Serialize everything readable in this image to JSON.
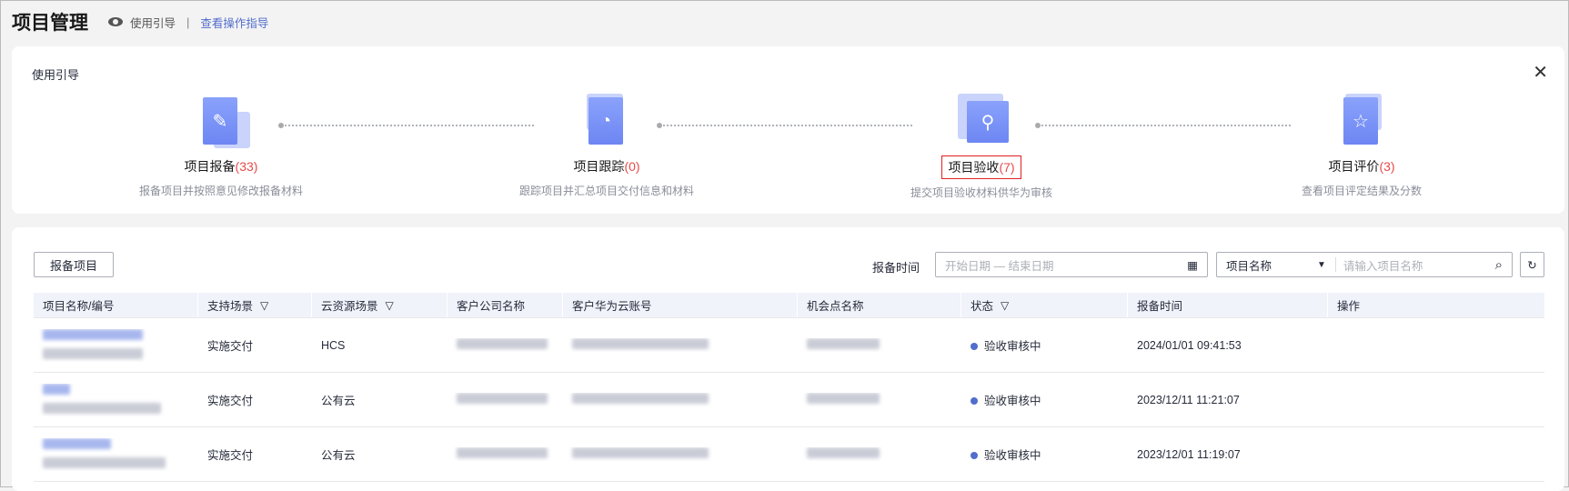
{
  "header": {
    "title": "项目管理",
    "guide_label": "使用引导",
    "separator": "|",
    "guide_link": "查看操作指导"
  },
  "guide": {
    "title": "使用引导",
    "close": "✕",
    "steps": [
      {
        "name": "项目报备",
        "count": "(33)",
        "desc": "报备项目并按照意见修改报备材料",
        "icon": "document-edit-icon"
      },
      {
        "name": "项目跟踪",
        "count": "(0)",
        "desc": "跟踪项目并汇总项目交付信息和材料",
        "icon": "gauge-icon"
      },
      {
        "name": "项目验收",
        "count": "(7)",
        "desc": "提交项目验收材料供华为审核",
        "icon": "stamp-icon"
      },
      {
        "name": "项目评价",
        "count": "(3)",
        "desc": "查看项目评定结果及分数",
        "icon": "star-document-icon"
      }
    ]
  },
  "toolbar": {
    "report_button": "报备项目",
    "time_label": "报备时间",
    "date_placeholder": "开始日期 — 结束日期",
    "search_field": "项目名称",
    "search_placeholder": "请输入项目名称"
  },
  "table": {
    "columns": [
      "项目名称/编号",
      "支持场景",
      "云资源场景",
      "客户公司名称",
      "客户华为云账号",
      "机会点名称",
      "状态",
      "报备时间",
      "操作"
    ],
    "rows": [
      {
        "scene": "实施交付",
        "cloud": "HCS",
        "status": "验收审核中",
        "time": "2024/01/01 09:41:53"
      },
      {
        "scene": "实施交付",
        "cloud": "公有云",
        "status": "验收审核中",
        "time": "2023/12/11 11:21:07"
      },
      {
        "scene": "实施交付",
        "cloud": "公有云",
        "status": "验收审核中",
        "time": "2023/12/01 11:19:07"
      }
    ]
  },
  "colors": {
    "accent": "#526ecc",
    "count": "#e84a4a",
    "highlight": "#e02020"
  }
}
